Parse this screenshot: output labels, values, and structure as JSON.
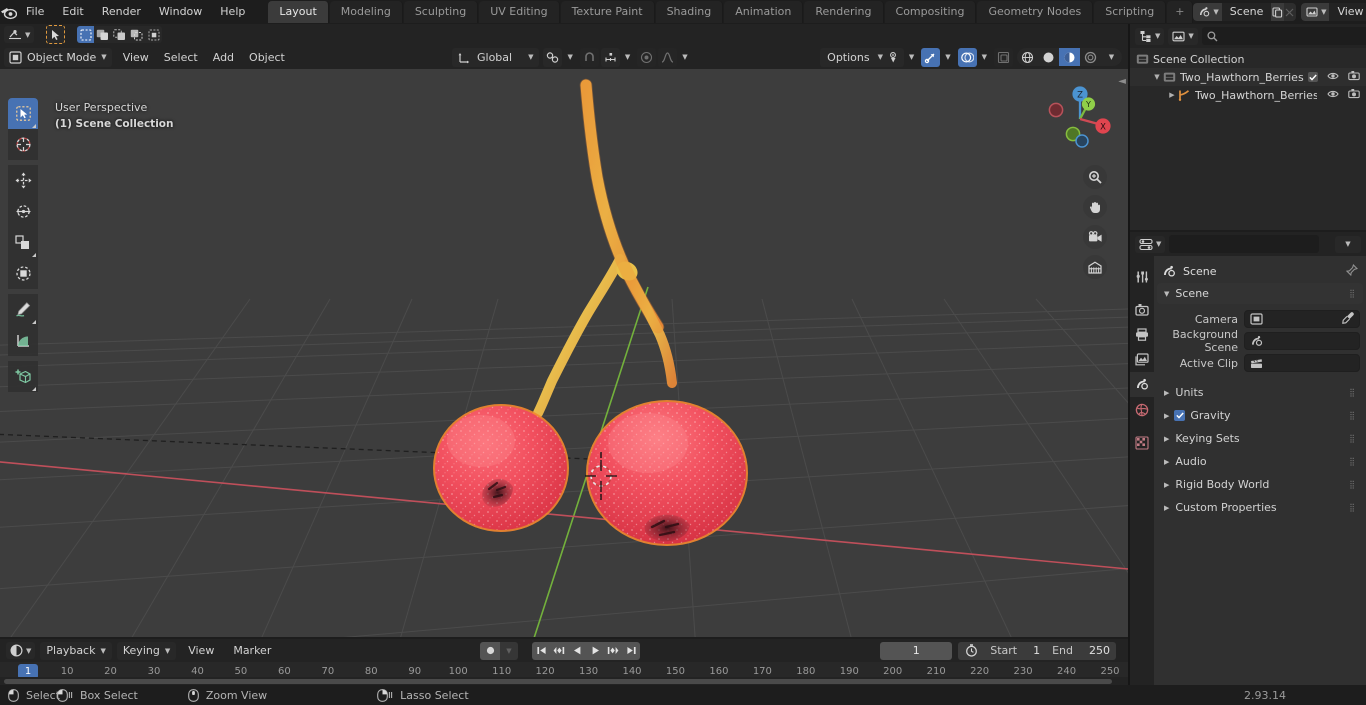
{
  "app": {
    "version": "2.93.14"
  },
  "topbar": {
    "menus": [
      "File",
      "Edit",
      "Render",
      "Window",
      "Help"
    ],
    "workspaces": [
      {
        "label": "Layout",
        "active": true
      },
      {
        "label": "Modeling",
        "active": false
      },
      {
        "label": "Sculpting",
        "active": false
      },
      {
        "label": "UV Editing",
        "active": false
      },
      {
        "label": "Texture Paint",
        "active": false
      },
      {
        "label": "Shading",
        "active": false
      },
      {
        "label": "Animation",
        "active": false
      },
      {
        "label": "Rendering",
        "active": false
      },
      {
        "label": "Compositing",
        "active": false
      },
      {
        "label": "Geometry Nodes",
        "active": false
      },
      {
        "label": "Scripting",
        "active": false
      }
    ],
    "add_workspace_label": "+",
    "scene_name": "Scene",
    "view_layer_name": "View Layer"
  },
  "viewport": {
    "mode": "Object Mode",
    "menus": [
      "View",
      "Select",
      "Add",
      "Object"
    ],
    "transform_orientation": "Global",
    "options_label": "Options",
    "overlay_line1": "User Perspective",
    "overlay_line2": "(1) Scene Collection",
    "tools": [
      "tweak-select-tool",
      "cursor-tool",
      "move-tool",
      "rotate-tool",
      "scale-tool",
      "transform-tool",
      "annotate-tool",
      "measure-tool",
      "add-cube-tool"
    ],
    "select_modes": [
      "set-select",
      "extend-select",
      "subtract-select",
      "invert-select",
      "intersect-select"
    ],
    "gizmo_axes": [
      "Z",
      "Y",
      "X"
    ],
    "nav_buttons": [
      "zoom-icon",
      "pan-icon",
      "camera-icon",
      "orthographic-icon"
    ]
  },
  "outliner": {
    "search_placeholder": "",
    "search_value": "",
    "rows": [
      {
        "label": "Scene Collection",
        "indent": 0,
        "icon": "collection-icon",
        "has_toggles": false
      },
      {
        "label": "Two_Hawthorn_Berries",
        "indent": 1,
        "icon": "collection-icon",
        "has_toggles": true,
        "checkbox": true
      },
      {
        "label": "Two_Hawthorn_Berries_C",
        "indent": 2,
        "icon": "object-data-icon",
        "has_toggles": true,
        "checkbox": false
      }
    ]
  },
  "properties": {
    "search_value": "",
    "breadcrumb": "Scene",
    "panels": [
      {
        "title": "Scene",
        "expanded": true,
        "grip": true
      }
    ],
    "fields": [
      {
        "label": "Camera",
        "value": "",
        "icon": "camera-object-icon",
        "eyedropper": true
      },
      {
        "label": "Background Scene",
        "value": "",
        "icon": "scene-icon",
        "eyedropper": false
      },
      {
        "label": "Active Clip",
        "value": "",
        "icon": "clip-icon",
        "eyedropper": false
      }
    ],
    "sections": [
      {
        "label": "Units",
        "checkbox": false
      },
      {
        "label": "Gravity",
        "checkbox": true
      },
      {
        "label": "Keying Sets",
        "checkbox": false
      },
      {
        "label": "Audio",
        "checkbox": false
      },
      {
        "label": "Rigid Body World",
        "checkbox": false
      },
      {
        "label": "Custom Properties",
        "checkbox": false
      }
    ],
    "tabs": [
      "tool-icon",
      "render-icon",
      "output-icon",
      "view-layer-icon",
      "scene-icon",
      "world-icon",
      "texture-icon"
    ]
  },
  "timeline": {
    "menus": [
      "Playback",
      "Keying",
      "View",
      "Marker"
    ],
    "current_frame": "1",
    "start_label": "Start",
    "start_value": "1",
    "end_label": "End",
    "end_value": "250",
    "playhead_frame": "1",
    "ticks": [
      10,
      20,
      30,
      40,
      50,
      60,
      70,
      80,
      90,
      100,
      110,
      120,
      130,
      140,
      150,
      160,
      170,
      180,
      190,
      200,
      210,
      220,
      230,
      240,
      250
    ]
  },
  "statusbar": {
    "items": [
      {
        "label": "Select",
        "mouse": "left"
      },
      {
        "label": "Box Select",
        "mouse": "left-drag"
      },
      {
        "label": "Zoom View",
        "mouse": "middle"
      },
      {
        "label": "Lasso Select",
        "mouse": "right-drag"
      }
    ],
    "version": "2.93.14"
  },
  "colors": {
    "accent": "#4772b3",
    "background": "#303030",
    "header": "#232323",
    "berry_red": "#ef4455",
    "stem_orange": "#e0913f",
    "axis_x_red": "#c44a55",
    "axis_y_green": "#7fbf3f"
  }
}
